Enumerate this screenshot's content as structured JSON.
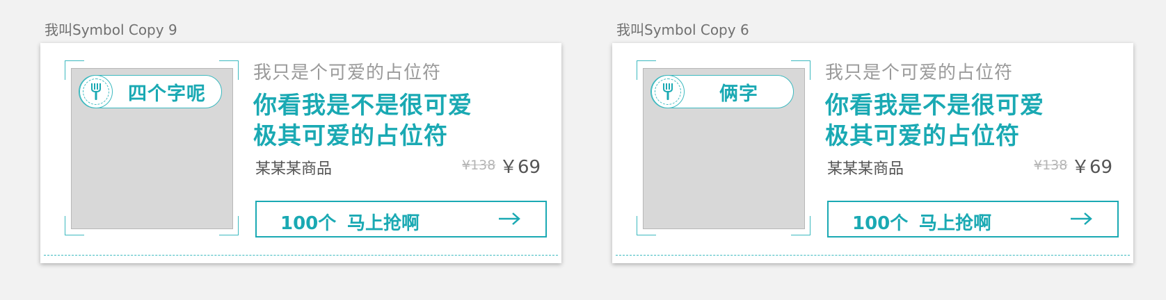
{
  "colors": {
    "accent": "#1aa9b3",
    "background": "#f2f2f2",
    "card": "#ffffff",
    "placeholder": "#d8d8d8"
  },
  "artboards": [
    {
      "label": "我叫Symbol Copy 9",
      "tag_icon": "fork-icon",
      "tag_text": "四个字呢",
      "subtitle": "我只是个可爱的占位符",
      "headline_line1": "你看我是不是很可爱",
      "headline_line2": "极其可爱的占位符",
      "product_name": "某某某商品",
      "price_old": "¥138",
      "price_new": "￥69",
      "buy_count": "100个",
      "buy_label": "马上抢啊",
      "buy_icon": "arrow-right-icon"
    },
    {
      "label": "我叫Symbol Copy 6",
      "tag_icon": "fork-icon",
      "tag_text": "俩字",
      "subtitle": "我只是个可爱的占位符",
      "headline_line1": "你看我是不是很可爱",
      "headline_line2": "极其可爱的占位符",
      "product_name": "某某某商品",
      "price_old": "¥138",
      "price_new": "￥69",
      "buy_count": "100个",
      "buy_label": "马上抢啊",
      "buy_icon": "arrow-right-icon"
    }
  ]
}
